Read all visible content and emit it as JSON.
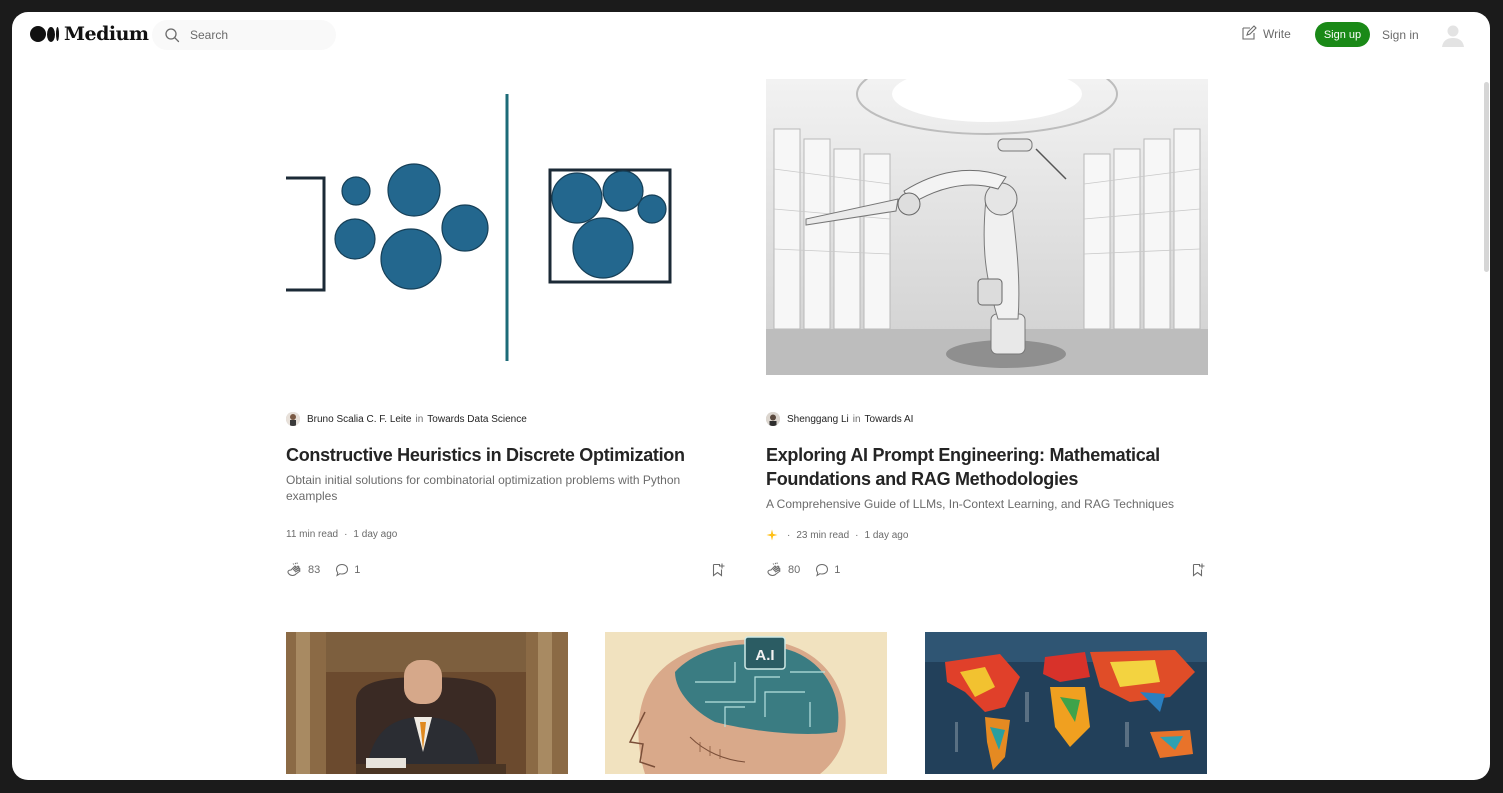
{
  "header": {
    "logo_text": "Medium",
    "search_placeholder": "Search",
    "write_label": "Write",
    "signup_label": "Sign up",
    "signin_label": "Sign in"
  },
  "colors": {
    "brand_green": "#1a8917",
    "accent_blue": "#23678e",
    "star": "#ffc017"
  },
  "articles": [
    {
      "author": "Bruno Scalia C. F. Leite",
      "in_label": "in",
      "publication": "Towards Data Science",
      "title": "Constructive Heuristics in Discrete Optimization",
      "subtitle": "Obtain initial solutions for combinatorial optimization problems with Python examples",
      "read_time": "11 min read",
      "age": "1 day ago",
      "claps": "83",
      "comments": "1"
    },
    {
      "author": "Shenggang Li",
      "in_label": "in",
      "publication": "Towards AI",
      "title": "Exploring AI Prompt Engineering: Mathematical Foundations and RAG Methodologies",
      "subtitle": "A Comprehensive Guide of LLMs, In-Context Learning, and RAG Techniques",
      "read_time": "23 min read",
      "age": "1 day ago",
      "claps": "80",
      "comments": "1",
      "member_only": true
    }
  ],
  "thumbnails": [
    {
      "name": "man-at-desk-image"
    },
    {
      "name": "ai-brain-head-image",
      "badge_text": "A.I"
    },
    {
      "name": "colorful-world-map-image"
    }
  ],
  "separator": "·"
}
